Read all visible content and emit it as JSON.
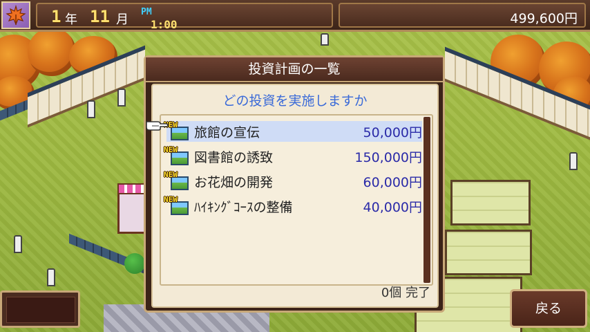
{
  "hud": {
    "year": "1",
    "year_unit": "年",
    "month": "11",
    "month_unit": "月",
    "ampm": "PM",
    "time": "1:00",
    "money": "499,600円"
  },
  "dialog": {
    "title": "投資計画の一覧",
    "question": "どの投資を実施しますか",
    "items": [
      {
        "badge": "NEW",
        "name": "旅館の宣伝",
        "price": "50,000円",
        "selected": true
      },
      {
        "badge": "NEW",
        "name": "図書館の誘致",
        "price": "150,000円",
        "selected": false
      },
      {
        "badge": "NEW",
        "name": "お花畑の開発",
        "price": "60,000円",
        "selected": false
      },
      {
        "badge": "NEW",
        "name": "ﾊｲｷﾝｸﾞｺｰｽの整備",
        "price": "40,000円",
        "selected": false
      }
    ],
    "count_text": "0個",
    "done_label": "完了"
  },
  "buttons": {
    "back_label": "戻る"
  },
  "colors": {
    "question_text": "#3a6ad8",
    "price_text": "#2a2aa8",
    "selection": "#cfdcf6",
    "date_digits": "#ffe070",
    "ampm": "#40d0ff"
  },
  "icons": {
    "season": "maple-leaf-icon",
    "item": "new-item-picture-icon",
    "cursor": "pointing-hand-icon"
  }
}
